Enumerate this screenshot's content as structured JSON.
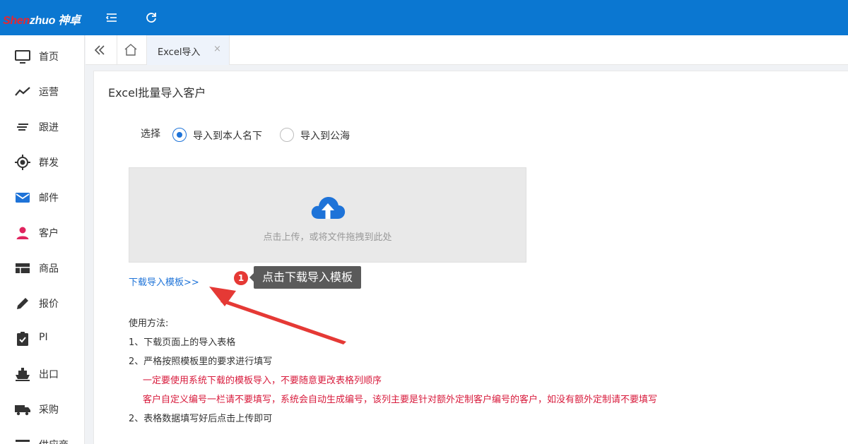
{
  "brand": {
    "logo_red": "Shen",
    "logo_white": "zhuo 神卓"
  },
  "sidebar": {
    "items": [
      {
        "label": "首页",
        "icon": "monitor-icon"
      },
      {
        "label": "运营",
        "icon": "trend-icon"
      },
      {
        "label": "跟进",
        "icon": "lines-icon"
      },
      {
        "label": "群发",
        "icon": "target-icon"
      },
      {
        "label": "邮件",
        "icon": "mail-icon"
      },
      {
        "label": "客户",
        "icon": "user-icon"
      },
      {
        "label": "商品",
        "icon": "table-icon"
      },
      {
        "label": "报价",
        "icon": "pencil-icon"
      },
      {
        "label": "PI",
        "icon": "clipboard-check-icon"
      },
      {
        "label": "出口",
        "icon": "ship-icon"
      },
      {
        "label": "采购",
        "icon": "truck-icon"
      },
      {
        "label": "供应商",
        "icon": "list-icon"
      }
    ]
  },
  "tabs": {
    "active_label": "Excel导入",
    "close_glyph": "×"
  },
  "page": {
    "title": "Excel批量导入客户",
    "choose_label": "选择",
    "radio_options": [
      {
        "label": "导入到本人名下",
        "checked": true
      },
      {
        "label": "导入到公海",
        "checked": false
      }
    ],
    "upload_text": "点击上传，或将文件拖拽到此处",
    "download_link": "下载导入模板>>",
    "usage": {
      "title": "使用方法:",
      "step1": "1、下载页面上的导入表格",
      "step2": "2、严格按照模板里的要求进行填写",
      "warn1": "一定要使用系统下载的模板导入，不要随意更改表格列顺序",
      "warn2": "客户自定义编号一栏请不要填写，系统会自动生成编号，该列主要是针对额外定制客户编号的客户，如没有额外定制请不要填写",
      "step3": "2、表格数据填写好后点击上传即可"
    }
  },
  "annotation": {
    "badge": "1",
    "tip": "点击下载导入模板"
  },
  "colors": {
    "header": "#0b77d1",
    "accent": "#1e73d8",
    "warn": "#d81b3c",
    "arrow": "#e53935"
  }
}
